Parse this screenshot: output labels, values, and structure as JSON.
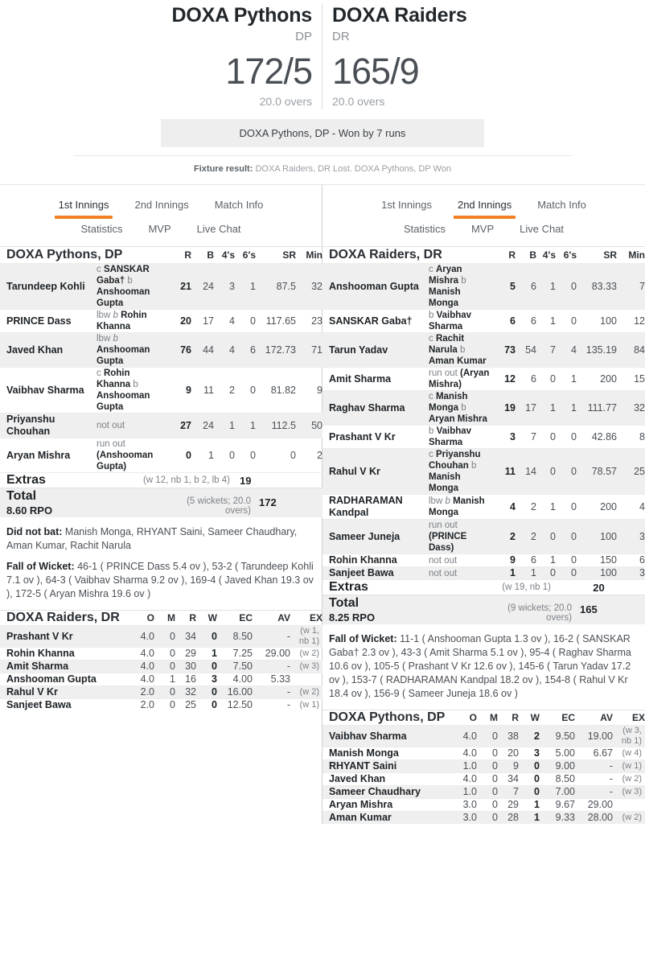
{
  "header": {
    "left": {
      "team": "DOXA Pythons",
      "abbr": "DP",
      "score": "172/5",
      "overs": "20.0 overs"
    },
    "right": {
      "team": "DOXA Raiders",
      "abbr": "DR",
      "score": "165/9",
      "overs": "20.0 overs"
    },
    "result_banner": "DOXA Pythons, DP - Won by 7 runs",
    "fixture_label": "Fixture result:",
    "fixture_text": "DOXA Raiders, DR Lost. DOXA Pythons, DP Won"
  },
  "tabs": {
    "row1": [
      "1st Innings",
      "2nd Innings",
      "Match Info"
    ],
    "row2": [
      "Statistics",
      "MVP",
      "Live Chat"
    ],
    "left_active": "1st Innings",
    "right_active": "2nd Innings"
  },
  "accent_color": "#f28020",
  "batting_columns": [
    "R",
    "B",
    "4's",
    "6's",
    "SR",
    "Min"
  ],
  "bowling_columns": [
    "O",
    "M",
    "R",
    "W",
    "EC",
    "AV",
    "EX"
  ],
  "left_panel": {
    "batting": {
      "title": "DOXA Pythons, DP",
      "rows": [
        {
          "name": "Tarundeep Kohli",
          "dismissal": "c SANSKAR Gaba† b Anshooman Gupta",
          "dismissal_plain": "c ",
          "r": "21",
          "b": "24",
          "fours": "3",
          "sixes": "1",
          "sr": "87.5",
          "min": "32"
        },
        {
          "name": "PRINCE Dass",
          "dismissal": "lbw b Rohin Khanna",
          "r": "20",
          "b": "17",
          "fours": "4",
          "sixes": "0",
          "sr": "117.65",
          "min": "23"
        },
        {
          "name": "Javed Khan",
          "dismissal": "lbw b Anshooman Gupta",
          "r": "76",
          "b": "44",
          "fours": "4",
          "sixes": "6",
          "sr": "172.73",
          "min": "71"
        },
        {
          "name": "Vaibhav Sharma",
          "dismissal": "c Rohin Khanna b Anshooman Gupta",
          "r": "9",
          "b": "11",
          "fours": "2",
          "sixes": "0",
          "sr": "81.82",
          "min": "9"
        },
        {
          "name": "Priyanshu Chouhan",
          "dismissal": "not out",
          "r": "27",
          "b": "24",
          "fours": "1",
          "sixes": "1",
          "sr": "112.5",
          "min": "50"
        },
        {
          "name": "Aryan Mishra",
          "dismissal": "run out (Anshooman Gupta)",
          "r": "0",
          "b": "1",
          "fours": "0",
          "sixes": "0",
          "sr": "0",
          "min": "2"
        }
      ],
      "extras": {
        "label": "Extras",
        "detail": "(w 12, nb 1, b 2, lb 4)",
        "value": "19"
      },
      "total": {
        "label": "Total",
        "rpo": "8.60 RPO",
        "detail": "(5 wickets; 20.0 overs)",
        "value": "172"
      },
      "did_not_bat_label": "Did not bat:",
      "did_not_bat": "Manish Monga, RHYANT Saini, Sameer Chaudhary, Aman Kumar, Rachit Narula",
      "fow_label": "Fall of Wicket:",
      "fow": "46-1 ( PRINCE Dass 5.4 ov ), 53-2 ( Tarundeep Kohli 7.1 ov ), 64-3 ( Vaibhav Sharma 9.2 ov ), 169-4 ( Javed Khan 19.3 ov ), 172-5 ( Aryan Mishra 19.6 ov )"
    },
    "bowling": {
      "title": "DOXA Raiders, DR",
      "rows": [
        {
          "name": "Prashant V Kr",
          "o": "4.0",
          "m": "0",
          "r": "34",
          "w": "0",
          "ec": "8.50",
          "av": "-",
          "ex": "(w 1, nb 1)"
        },
        {
          "name": "Rohin Khanna",
          "o": "4.0",
          "m": "0",
          "r": "29",
          "w": "1",
          "ec": "7.25",
          "av": "29.00",
          "ex": "(w 2)"
        },
        {
          "name": "Amit Sharma",
          "o": "4.0",
          "m": "0",
          "r": "30",
          "w": "0",
          "ec": "7.50",
          "av": "-",
          "ex": "(w 3)"
        },
        {
          "name": "Anshooman Gupta",
          "o": "4.0",
          "m": "1",
          "r": "16",
          "w": "3",
          "ec": "4.00",
          "av": "5.33",
          "ex": ""
        },
        {
          "name": "Rahul V Kr",
          "o": "2.0",
          "m": "0",
          "r": "32",
          "w": "0",
          "ec": "16.00",
          "av": "-",
          "ex": "(w 2)"
        },
        {
          "name": "Sanjeet Bawa",
          "o": "2.0",
          "m": "0",
          "r": "25",
          "w": "0",
          "ec": "12.50",
          "av": "-",
          "ex": "(w 1)"
        }
      ]
    }
  },
  "right_panel": {
    "batting": {
      "title": "DOXA Raiders, DR",
      "rows": [
        {
          "name": "Anshooman Gupta",
          "dismissal": "c Aryan Mishra b Manish Monga",
          "r": "5",
          "b": "6",
          "fours": "1",
          "sixes": "0",
          "sr": "83.33",
          "min": "7"
        },
        {
          "name": "SANSKAR Gaba†",
          "dismissal": "b Vaibhav Sharma",
          "r": "6",
          "b": "6",
          "fours": "1",
          "sixes": "0",
          "sr": "100",
          "min": "12"
        },
        {
          "name": "Tarun Yadav",
          "dismissal": "c Rachit Narula b Aman Kumar",
          "r": "73",
          "b": "54",
          "fours": "7",
          "sixes": "4",
          "sr": "135.19",
          "min": "84"
        },
        {
          "name": "Amit Sharma",
          "dismissal": "run out (Aryan Mishra)",
          "r": "12",
          "b": "6",
          "fours": "0",
          "sixes": "1",
          "sr": "200",
          "min": "15"
        },
        {
          "name": "Raghav Sharma",
          "dismissal": "c Manish Monga b Aryan Mishra",
          "r": "19",
          "b": "17",
          "fours": "1",
          "sixes": "1",
          "sr": "111.77",
          "min": "32"
        },
        {
          "name": "Prashant V Kr",
          "dismissal": "b Vaibhav Sharma",
          "r": "3",
          "b": "7",
          "fours": "0",
          "sixes": "0",
          "sr": "42.86",
          "min": "8"
        },
        {
          "name": "Rahul V Kr",
          "dismissal": "c Priyanshu Chouhan b Manish Monga",
          "r": "11",
          "b": "14",
          "fours": "0",
          "sixes": "0",
          "sr": "78.57",
          "min": "25"
        },
        {
          "name": "RADHARAMAN Kandpal",
          "dismissal": "lbw b Manish Monga",
          "r": "4",
          "b": "2",
          "fours": "1",
          "sixes": "0",
          "sr": "200",
          "min": "4"
        },
        {
          "name": "Sameer Juneja",
          "dismissal": "run out (PRINCE Dass)",
          "r": "2",
          "b": "2",
          "fours": "0",
          "sixes": "0",
          "sr": "100",
          "min": "3"
        },
        {
          "name": "Rohin Khanna",
          "dismissal": "not out",
          "r": "9",
          "b": "6",
          "fours": "1",
          "sixes": "0",
          "sr": "150",
          "min": "6"
        },
        {
          "name": "Sanjeet Bawa",
          "dismissal": "not out",
          "r": "1",
          "b": "1",
          "fours": "0",
          "sixes": "0",
          "sr": "100",
          "min": "3"
        }
      ],
      "extras": {
        "label": "Extras",
        "detail": "(w 19, nb 1)",
        "value": "20"
      },
      "total": {
        "label": "Total",
        "rpo": "8.25 RPO",
        "detail": "(9 wickets; 20.0 overs)",
        "value": "165"
      },
      "fow_label": "Fall of Wicket:",
      "fow": "11-1 ( Anshooman Gupta 1.3 ov ), 16-2 ( SANSKAR Gaba† 2.3 ov ), 43-3 ( Amit Sharma 5.1 ov ), 95-4 ( Raghav Sharma 10.6 ov ), 105-5 ( Prashant V Kr 12.6 ov ), 145-6 ( Tarun Yadav 17.2 ov ), 153-7 ( RADHARAMAN Kandpal 18.2 ov ), 154-8 ( Rahul V Kr 18.4 ov ), 156-9 ( Sameer Juneja 18.6 ov )"
    },
    "bowling": {
      "title": "DOXA Pythons, DP",
      "rows": [
        {
          "name": "Vaibhav Sharma",
          "o": "4.0",
          "m": "0",
          "r": "38",
          "w": "2",
          "ec": "9.50",
          "av": "19.00",
          "ex": "(w 3, nb 1)"
        },
        {
          "name": "Manish Monga",
          "o": "4.0",
          "m": "0",
          "r": "20",
          "w": "3",
          "ec": "5.00",
          "av": "6.67",
          "ex": "(w 4)"
        },
        {
          "name": "RHYANT Saini",
          "o": "1.0",
          "m": "0",
          "r": "9",
          "w": "0",
          "ec": "9.00",
          "av": "-",
          "ex": "(w 1)"
        },
        {
          "name": "Javed Khan",
          "o": "4.0",
          "m": "0",
          "r": "34",
          "w": "0",
          "ec": "8.50",
          "av": "-",
          "ex": "(w 2)"
        },
        {
          "name": "Sameer Chaudhary",
          "o": "1.0",
          "m": "0",
          "r": "7",
          "w": "0",
          "ec": "7.00",
          "av": "-",
          "ex": "(w 3)"
        },
        {
          "name": "Aryan Mishra",
          "o": "3.0",
          "m": "0",
          "r": "29",
          "w": "1",
          "ec": "9.67",
          "av": "29.00",
          "ex": ""
        },
        {
          "name": "Aman Kumar",
          "o": "3.0",
          "m": "0",
          "r": "28",
          "w": "1",
          "ec": "9.33",
          "av": "28.00",
          "ex": "(w 2)"
        }
      ]
    }
  }
}
